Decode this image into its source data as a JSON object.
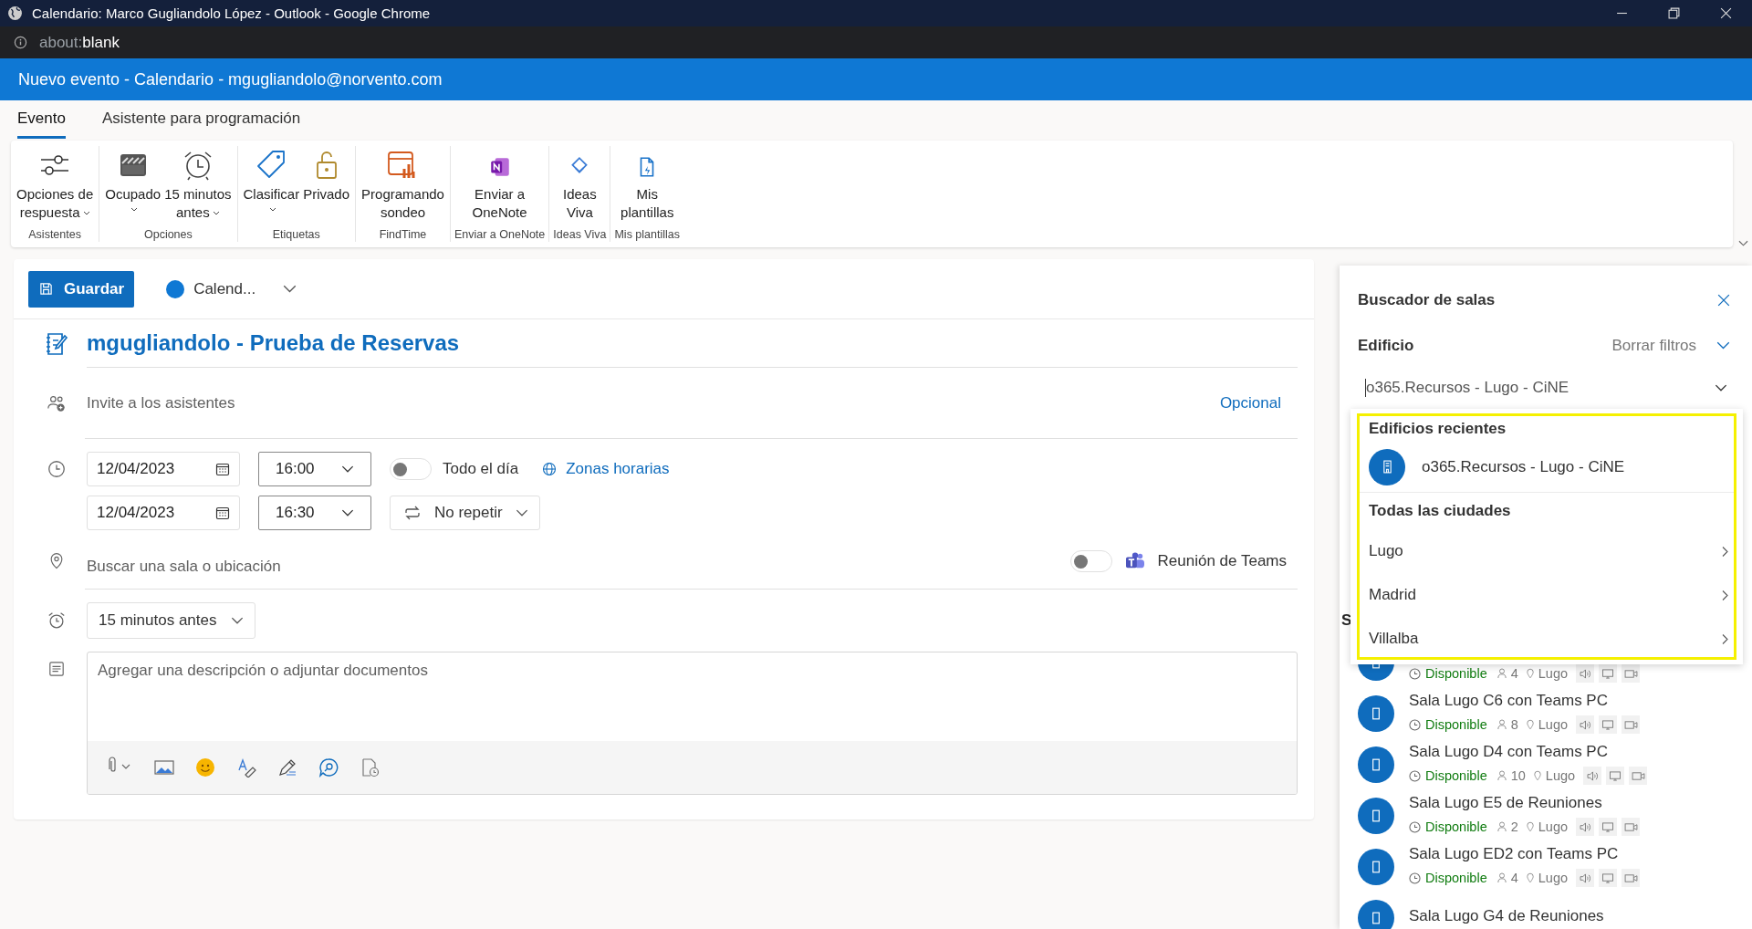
{
  "window": {
    "title": "Calendario: Marco Gugliandolo López - Outlook - Google Chrome"
  },
  "address_bar": {
    "prefix": "about:",
    "value": "blank"
  },
  "header": {
    "title": "Nuevo evento - Calendario - mgugliandolo@norvento.com"
  },
  "tabs": [
    {
      "label": "Evento",
      "selected": true
    },
    {
      "label": "Asistente para programación",
      "selected": false
    }
  ],
  "ribbon": {
    "groups": [
      {
        "label": "Asistentes",
        "items": [
          {
            "kind": "sliders",
            "lines": [
              "Opciones de",
              "respuesta"
            ],
            "dropdown": true
          }
        ]
      },
      {
        "label": "Opciones",
        "items": [
          {
            "kind": "busy",
            "lines": [
              "Ocupado"
            ],
            "dropdown": true
          },
          {
            "kind": "alarm",
            "lines": [
              "15 minutos",
              "antes"
            ],
            "dropdown": true
          }
        ]
      },
      {
        "label": "Etiquetas",
        "items": [
          {
            "kind": "tag",
            "lines": [
              "Clasificar"
            ],
            "dropdown": true
          },
          {
            "kind": "lock",
            "lines": [
              "Privado"
            ],
            "dropdown": false
          }
        ]
      },
      {
        "label": "FindTime",
        "items": [
          {
            "kind": "poll",
            "lines": [
              "Programando",
              "sondeo"
            ],
            "dropdown": false
          }
        ]
      },
      {
        "label": "Enviar a OneNote",
        "items": [
          {
            "kind": "onenote",
            "lines": [
              "Enviar a",
              "OneNote"
            ],
            "dropdown": false
          }
        ]
      },
      {
        "label": "Ideas Viva",
        "items": [
          {
            "kind": "viva",
            "lines": [
              "Ideas",
              "Viva"
            ],
            "dropdown": false
          }
        ]
      },
      {
        "label": "Mis plantillas",
        "items": [
          {
            "kind": "template",
            "lines": [
              "Mis",
              "plantillas"
            ],
            "dropdown": false
          }
        ]
      }
    ]
  },
  "event": {
    "save_label": "Guardar",
    "calendar": {
      "label": "Calend...",
      "color": "#0f78d4"
    },
    "title": "mgugliandolo - Prueba de Reservas",
    "attendees": {
      "placeholder": "Invite a los asistentes",
      "optional_link": "Opcional"
    },
    "start": {
      "date": "12/04/2023",
      "time": "16:00"
    },
    "end": {
      "date": "12/04/2023",
      "time": "16:30"
    },
    "all_day": {
      "label": "Todo el día",
      "on": false
    },
    "time_zones": "Zonas horarias",
    "repeat": "No repetir",
    "location": {
      "placeholder": "Buscar una sala o ubicación"
    },
    "teams": {
      "label": "Reunión de Teams",
      "on": false
    },
    "reminder": "15 minutos antes",
    "description": {
      "placeholder": "Agregar una descripción o adjuntar documentos"
    }
  },
  "room_finder": {
    "title": "Buscador de salas",
    "filter_label": "Edificio",
    "clear_filters": "Borrar filtros",
    "building": {
      "value": "o365.Recursos - Lugo - CiNE"
    },
    "dropdown": {
      "recent_heading": "Edificios recientes",
      "recent": [
        "o365.Recursos - Lugo - CiNE"
      ],
      "cities_heading": "Todas las ciudades",
      "cities": [
        "Lugo",
        "Madrid",
        "Villalba"
      ]
    },
    "list_heading": "S",
    "rooms": [
      {
        "status": "Disponible",
        "capacity": "4",
        "location": "Lugo"
      },
      {
        "name": "Sala Lugo C6 con Teams PC",
        "status": "Disponible",
        "capacity": "8",
        "location": "Lugo"
      },
      {
        "name": "Sala Lugo D4 con Teams PC",
        "status": "Disponible",
        "capacity": "10",
        "location": "Lugo"
      },
      {
        "name": "Sala Lugo E5 de Reuniones",
        "status": "Disponible",
        "capacity": "2",
        "location": "Lugo"
      },
      {
        "name": "Sala Lugo ED2 con Teams PC",
        "status": "Disponible",
        "capacity": "4",
        "location": "Lugo"
      },
      {
        "name": "Sala Lugo G4 de Reuniones"
      }
    ]
  }
}
